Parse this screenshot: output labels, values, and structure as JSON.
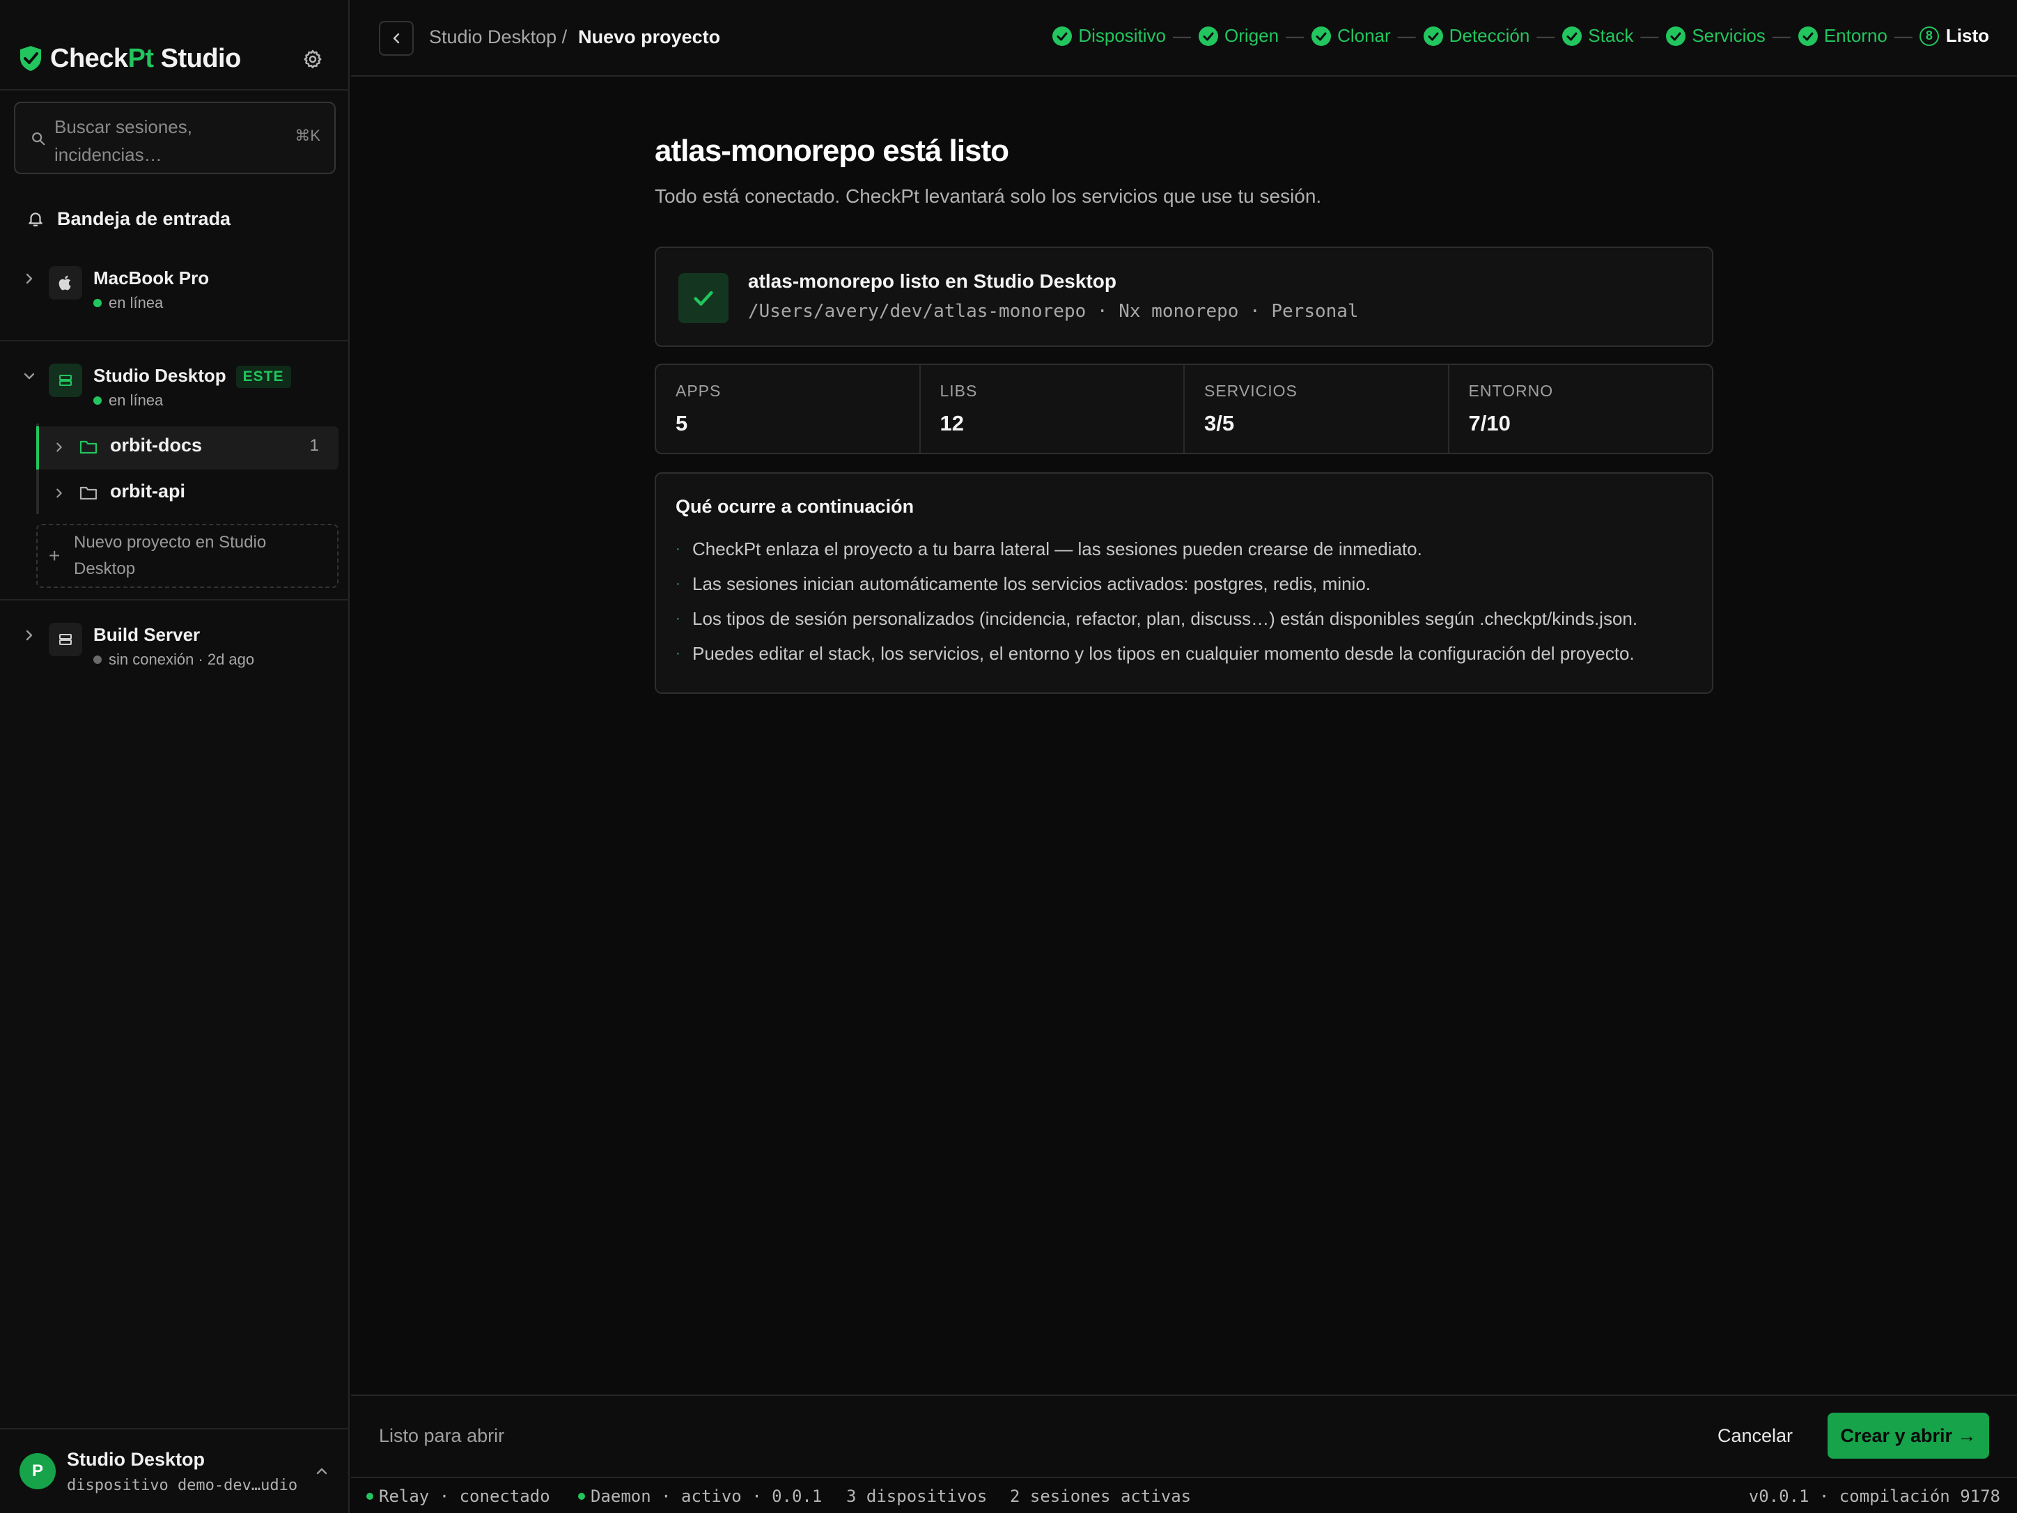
{
  "brand": {
    "name_prefix": "Check",
    "name_accent": "Pt",
    "name_suffix": " Studio",
    "accent_color": "#22c55e"
  },
  "search": {
    "placeholder": "Buscar sesiones, incidencias…",
    "shortcut": "⌘K"
  },
  "inbox": {
    "label": "Bandeja de entrada"
  },
  "devices": [
    {
      "name": "MacBook Pro",
      "status": "en línea",
      "status_color": "#22c55e",
      "icon": "apple-icon",
      "expanded": false
    },
    {
      "name": "Studio Desktop",
      "badge": "ESTE",
      "status": "en línea",
      "status_color": "#22c55e",
      "icon": "server-icon",
      "expanded": true,
      "projects": [
        {
          "name": "orbit-docs",
          "count": "1",
          "active": true
        },
        {
          "name": "orbit-api",
          "count": "",
          "active": false
        }
      ],
      "new_project_label": "Nuevo proyecto en Studio Desktop"
    },
    {
      "name": "Build Server",
      "status": "sin conexión · 2d ago",
      "status_color": "#6a6a6a",
      "icon": "server-icon",
      "expanded": false
    }
  ],
  "current_user": {
    "initial": "P",
    "name": "Studio Desktop",
    "subtitle": "dispositivo demo-dev…udio"
  },
  "topbar": {
    "breadcrumb_parent": "Studio Desktop /",
    "breadcrumb_current": "Nuevo proyecto",
    "steps": [
      {
        "label": "Dispositivo",
        "state": "done"
      },
      {
        "label": "Origen",
        "state": "done"
      },
      {
        "label": "Clonar",
        "state": "done"
      },
      {
        "label": "Detección",
        "state": "done"
      },
      {
        "label": "Stack",
        "state": "done"
      },
      {
        "label": "Servicios",
        "state": "done"
      },
      {
        "label": "Entorno",
        "state": "done"
      },
      {
        "label": "Listo",
        "state": "current",
        "number": "8"
      }
    ]
  },
  "main": {
    "title": "atlas-monorepo está listo",
    "subtitle": "Todo está conectado. CheckPt levantará solo los servicios que use tu sesión.",
    "ready_card": {
      "title": "atlas-monorepo listo en Studio Desktop",
      "details": "/Users/avery/dev/atlas-monorepo · Nx monorepo · Personal"
    },
    "stats": [
      {
        "label": "APPS",
        "value": "5"
      },
      {
        "label": "LIBS",
        "value": "12"
      },
      {
        "label": "SERVICIOS",
        "value": "3/5"
      },
      {
        "label": "ENTORNO",
        "value": "7/10"
      }
    ],
    "next": {
      "title": "Qué ocurre a continuación",
      "items": [
        "CheckPt enlaza el proyecto a tu barra lateral — las sesiones pueden crearse de inmediato.",
        "Las sesiones inician automáticamente los servicios activados: postgres, redis, minio.",
        "Los tipos de sesión personalizados (incidencia, refactor, plan, discuss…) están disponibles según .checkpt/kinds.json.",
        "Puedes editar el stack, los servicios, el entorno y los tipos en cualquier momento desde la configuración del proyecto."
      ]
    }
  },
  "actionbar": {
    "status": "Listo para abrir",
    "cancel": "Cancelar",
    "create": "Crear y abrir →"
  },
  "statusbar": {
    "relay": "Relay · conectado",
    "daemon": "Daemon · activo · 0.0.1",
    "devices": "3 dispositivos",
    "sessions": "2 sesiones activas",
    "version": "v0.0.1 · compilación 9178"
  }
}
